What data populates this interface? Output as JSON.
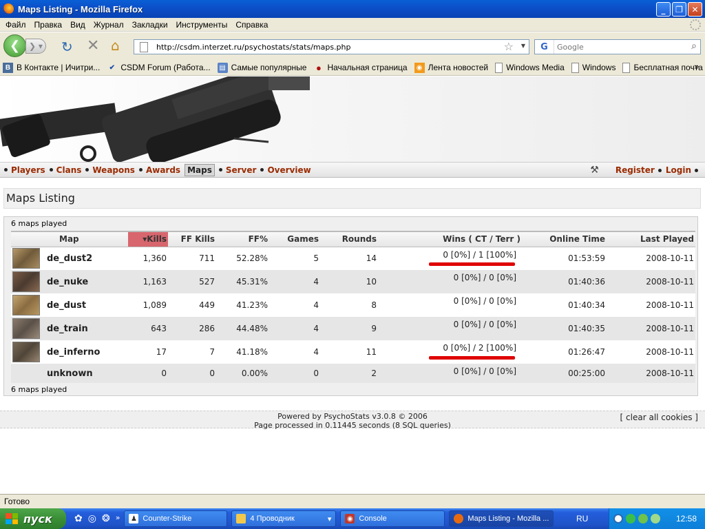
{
  "window": {
    "title": "Maps Listing - Mozilla Firefox",
    "min": "_",
    "max": "❐",
    "close": "✕"
  },
  "menu": [
    "Файл",
    "Правка",
    "Вид",
    "Журнал",
    "Закладки",
    "Инструменты",
    "Справка"
  ],
  "nav": {
    "url": "http://csdm.interzet.ru/psychostats/stats/maps.php",
    "search_engine": "G",
    "search_placeholder": "Google"
  },
  "bookmarks": [
    {
      "label": "В Контакте | Ичитри...",
      "icon": "vk-icon"
    },
    {
      "label": "CSDM Forum (Работа...",
      "icon": "checkmark-icon"
    },
    {
      "label": "Самые популярные",
      "icon": "folder-icon"
    },
    {
      "label": "Начальная страница",
      "icon": "dog-icon"
    },
    {
      "label": "Лента новостей",
      "icon": "rss-icon"
    },
    {
      "label": "Windows Media",
      "icon": "page-icon"
    },
    {
      "label": "Windows",
      "icon": "page-icon"
    },
    {
      "label": "Бесплатная почта Н...",
      "icon": "page-icon"
    }
  ],
  "site_nav": {
    "left": [
      "Players",
      "Clans",
      "Weapons",
      "Awards",
      "Maps",
      "Server",
      "Overview"
    ],
    "active": "Maps",
    "right": [
      "Register",
      "Login"
    ]
  },
  "page": {
    "heading": "Maps Listing",
    "count_label": "6 maps played"
  },
  "table": {
    "headers": {
      "map": "Map",
      "kills": "Kills",
      "ff_kills": "FF Kills",
      "ff_pct": "FF%",
      "games": "Games",
      "rounds": "Rounds",
      "wins": "Wins",
      "wins_sub": "( CT / Terr )",
      "online": "Online Time",
      "last": "Last Played"
    },
    "sorted_column": "Kills",
    "rows": [
      {
        "map": "de_dust2",
        "kills": "1,360",
        "ff_kills": "711",
        "ff_pct": "52.28%",
        "games": "5",
        "rounds": "14",
        "wins": "0 [0%] / 1 [100%]",
        "online": "01:53:59",
        "last": "2008-10-11",
        "thumb": "dust2"
      },
      {
        "map": "de_nuke",
        "kills": "1,163",
        "ff_kills": "527",
        "ff_pct": "45.31%",
        "games": "4",
        "rounds": "10",
        "wins": "0 [0%] / 0 [0%]",
        "online": "01:40:36",
        "last": "2008-10-11",
        "thumb": "nuke"
      },
      {
        "map": "de_dust",
        "kills": "1,089",
        "ff_kills": "449",
        "ff_pct": "41.23%",
        "games": "4",
        "rounds": "8",
        "wins": "0 [0%] / 0 [0%]",
        "online": "01:40:34",
        "last": "2008-10-11",
        "thumb": "dust"
      },
      {
        "map": "de_train",
        "kills": "643",
        "ff_kills": "286",
        "ff_pct": "44.48%",
        "games": "4",
        "rounds": "9",
        "wins": "0 [0%] / 0 [0%]",
        "online": "01:40:35",
        "last": "2008-10-11",
        "thumb": "train"
      },
      {
        "map": "de_inferno",
        "kills": "17",
        "ff_kills": "7",
        "ff_pct": "41.18%",
        "games": "4",
        "rounds": "11",
        "wins": "0 [0%] / 2 [100%]",
        "online": "01:26:47",
        "last": "2008-10-11",
        "thumb": "inferno"
      },
      {
        "map": "unknown",
        "kills": "0",
        "ff_kills": "0",
        "ff_pct": "0.00%",
        "games": "0",
        "rounds": "2",
        "wins": "0 [0%] / 0 [0%]",
        "online": "00:25:00",
        "last": "2008-10-11",
        "thumb": ""
      }
    ]
  },
  "footer": {
    "powered": "Powered by PsychoStats v3.0.8 © 2006",
    "processed": "Page processed in 0.11445 seconds (8 SQL queries)",
    "clear_cookies": "[ clear all cookies ]"
  },
  "status": "Готово",
  "taskbar": {
    "start": "пуск",
    "tasks": [
      {
        "label": "Counter-Strike",
        "width": 150
      },
      {
        "label": "4 Проводник",
        "width": 152
      },
      {
        "label": "Console",
        "width": 152
      },
      {
        "label": "Maps Listing - Mozilla ...",
        "width": 152
      }
    ],
    "lang": "RU",
    "clock": "12:58"
  },
  "colors": {
    "link": "#9a2a00",
    "sorted_header": "#d8666e",
    "highlight_line": "#e00000",
    "xp_blue": "#245edb"
  }
}
